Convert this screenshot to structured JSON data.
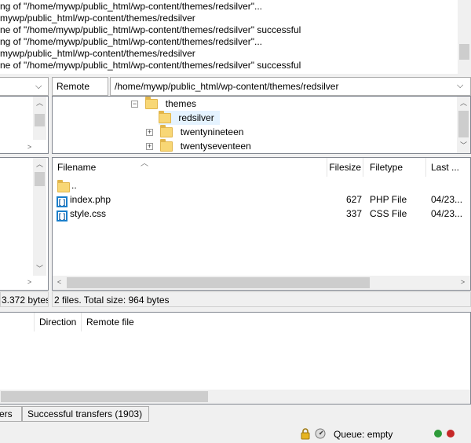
{
  "message_log": {
    "lines": [
      "ng of \"/home/mywp/public_html/wp-content/themes/redsilver\"...",
      "mywp/public_html/wp-content/themes/redsilver",
      "ne of \"/home/mywp/public_html/wp-content/themes/redsilver\" successful",
      "ng of \"/home/mywp/public_html/wp-content/themes/redsilver\"...",
      "mywp/public_html/wp-content/themes/redsilver",
      "ne of \"/home/mywp/public_html/wp-content/themes/redsilver\" successful"
    ]
  },
  "remote_site": {
    "label": "Remote site:",
    "path": "/home/mywp/public_html/wp-content/themes/redsilver"
  },
  "remote_tree": {
    "items": [
      {
        "label": "themes",
        "expander": "−"
      },
      {
        "label": "redsilver",
        "expander": ""
      },
      {
        "label": "twentynineteen",
        "expander": "+"
      },
      {
        "label": "twentyseventeen",
        "expander": "+"
      }
    ]
  },
  "remote_files": {
    "columns": [
      "Filename",
      "Filesize",
      "Filetype",
      "Last ..."
    ],
    "rows": [
      {
        "name": "..",
        "size": "",
        "type": "",
        "modified": ""
      },
      {
        "name": "index.php",
        "size": "627",
        "type": "PHP File",
        "modified": "04/23..."
      },
      {
        "name": "style.css",
        "size": "337",
        "type": "CSS File",
        "modified": "04/23..."
      }
    ]
  },
  "local_status": "3.372 bytes",
  "remote_status": "2 files. Total size: 964 bytes",
  "queue": {
    "columns": [
      "Direction",
      "Remote file"
    ]
  },
  "tabs": [
    "ers",
    "Successful transfers (1903)"
  ],
  "statusbar": {
    "queue_text": "Queue: empty",
    "indicator_colors": [
      "#2e9b3a",
      "#c62828"
    ]
  }
}
